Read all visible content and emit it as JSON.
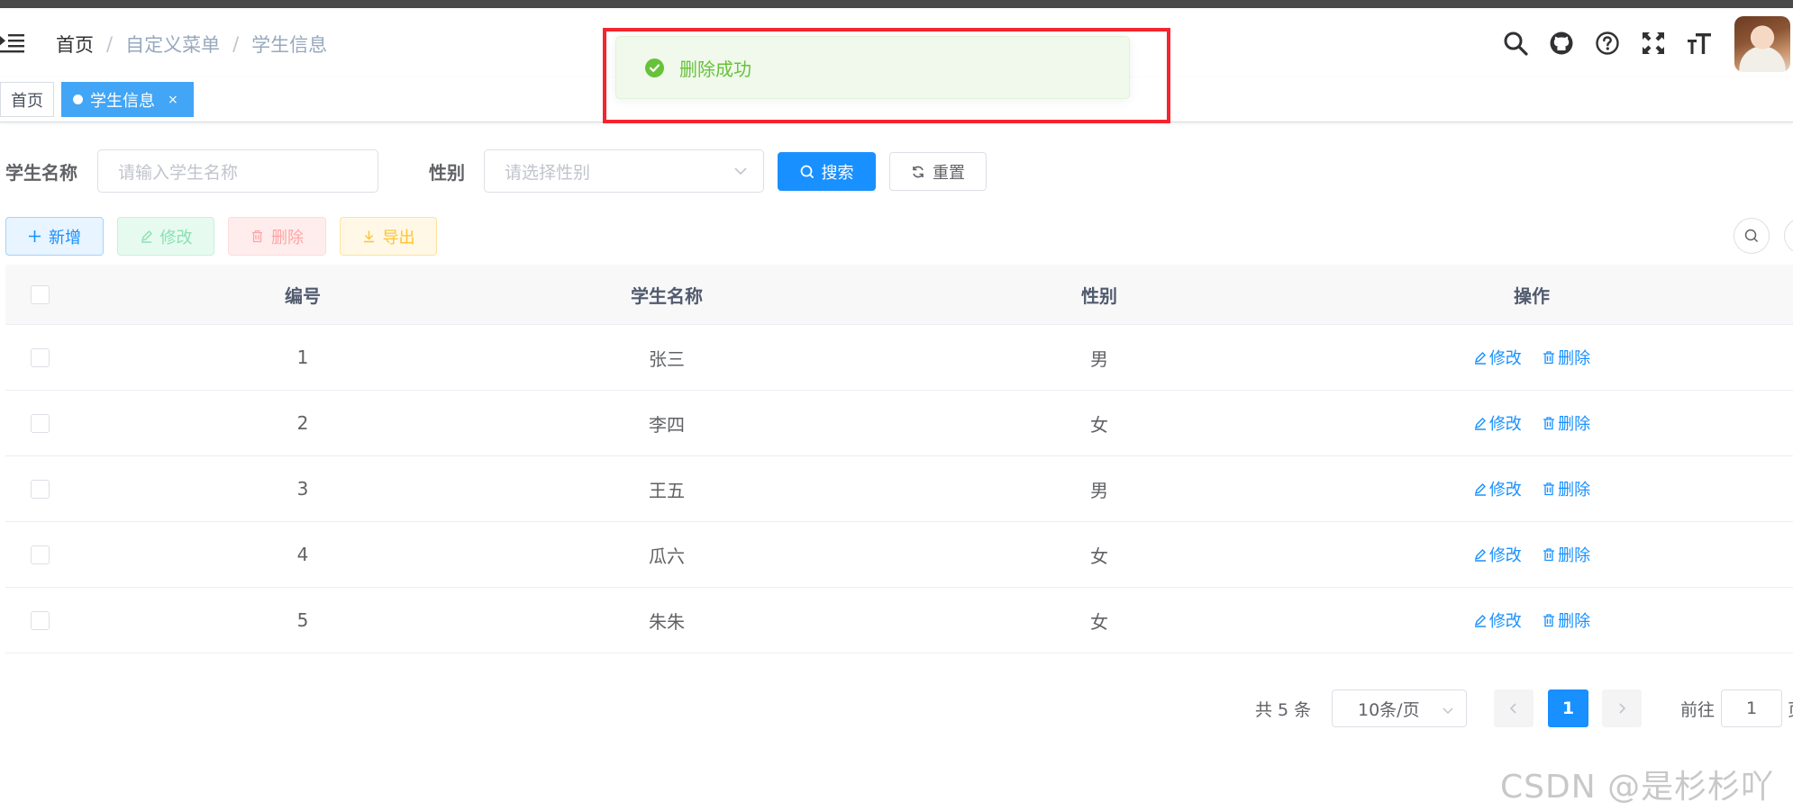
{
  "breadcrumb": {
    "home": "首页",
    "menu": "自定义菜单",
    "current": "学生信息",
    "separator": "/"
  },
  "tags": {
    "home": "首页",
    "active": "学生信息",
    "close": "×"
  },
  "toast": {
    "message": "删除成功",
    "type": "success",
    "color": "#67c23a"
  },
  "search": {
    "name_label": "学生名称",
    "name_placeholder": "请输入学生名称",
    "sex_label": "性别",
    "sex_placeholder": "请选择性别",
    "search_button": "搜索",
    "reset_button": "重置"
  },
  "toolbar": {
    "add": "新增",
    "edit": "修改",
    "delete": "删除",
    "export": "导出"
  },
  "table": {
    "headers": [
      "编号",
      "学生名称",
      "性别",
      "操作"
    ],
    "rows": [
      {
        "id": "1",
        "name": "张三",
        "sex": "男"
      },
      {
        "id": "2",
        "name": "李四",
        "sex": "女"
      },
      {
        "id": "3",
        "name": "王五",
        "sex": "男"
      },
      {
        "id": "4",
        "name": "瓜六",
        "sex": "女"
      },
      {
        "id": "5",
        "name": "朱朱",
        "sex": "女"
      }
    ],
    "op_edit": "修改",
    "op_delete": "删除"
  },
  "pagination": {
    "total": "共 5 条",
    "page_size": "10条/页",
    "current_page": "1",
    "goto_label": "前往",
    "goto_value": "1",
    "trail": "页"
  },
  "colors": {
    "primary": "#1890ff",
    "tag_active": "#42a5f5",
    "highlight": "#f5242e"
  },
  "watermark": "CSDN @是杉杉吖~"
}
